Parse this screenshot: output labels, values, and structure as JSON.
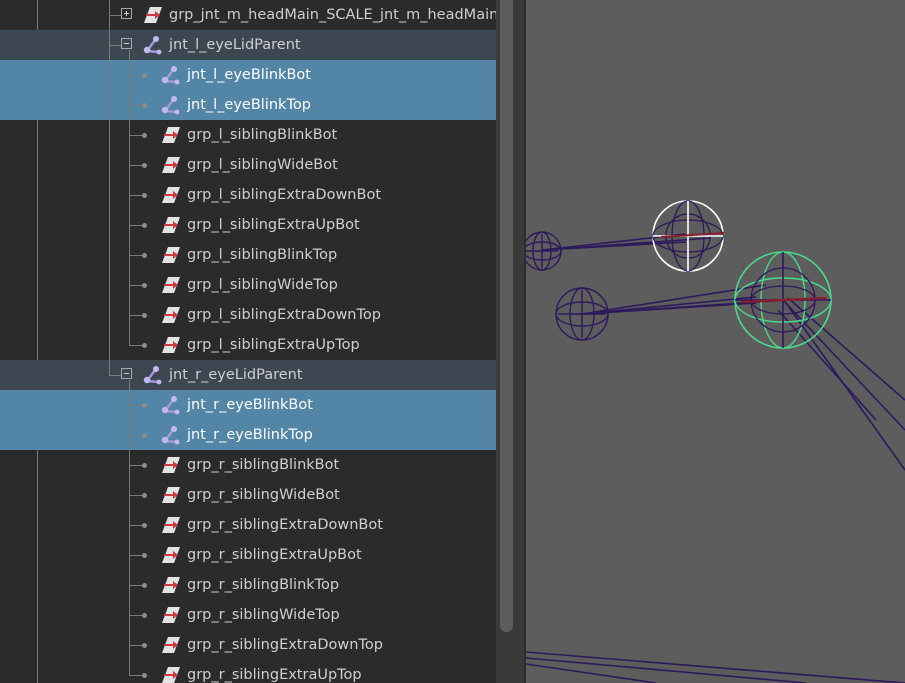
{
  "outliner": {
    "rows": [
      {
        "label": "grp_jnt_m_headMain_SCALE_jnt_m_headMain",
        "type": "group",
        "level": 1,
        "expander": "plus",
        "state": "normal"
      },
      {
        "label": "jnt_l_eyeLidParent",
        "type": "joint",
        "level": 1,
        "expander": "minus",
        "state": "parent"
      },
      {
        "label": "jnt_l_eyeBlinkBot",
        "type": "joint",
        "level": 2,
        "state": "selected"
      },
      {
        "label": "jnt_l_eyeBlinkTop",
        "type": "joint",
        "level": 2,
        "state": "selected"
      },
      {
        "label": "grp_l_siblingBlinkBot",
        "type": "group",
        "level": 2,
        "state": "normal"
      },
      {
        "label": "grp_l_siblingWideBot",
        "type": "group",
        "level": 2,
        "state": "normal"
      },
      {
        "label": "grp_l_siblingExtraDownBot",
        "type": "group",
        "level": 2,
        "state": "normal"
      },
      {
        "label": "grp_l_siblingExtraUpBot",
        "type": "group",
        "level": 2,
        "state": "normal"
      },
      {
        "label": "grp_l_siblingBlinkTop",
        "type": "group",
        "level": 2,
        "state": "normal"
      },
      {
        "label": "grp_l_siblingWideTop",
        "type": "group",
        "level": 2,
        "state": "normal"
      },
      {
        "label": "grp_l_siblingExtraDownTop",
        "type": "group",
        "level": 2,
        "state": "normal"
      },
      {
        "label": "grp_l_siblingExtraUpTop",
        "type": "group",
        "level": 2,
        "state": "normal"
      },
      {
        "label": "jnt_r_eyeLidParent",
        "type": "joint",
        "level": 1,
        "expander": "minus",
        "state": "parent"
      },
      {
        "label": "jnt_r_eyeBlinkBot",
        "type": "joint",
        "level": 2,
        "state": "selected"
      },
      {
        "label": "jnt_r_eyeBlinkTop",
        "type": "joint",
        "level": 2,
        "state": "selected"
      },
      {
        "label": "grp_r_siblingBlinkBot",
        "type": "group",
        "level": 2,
        "state": "normal"
      },
      {
        "label": "grp_r_siblingWideBot",
        "type": "group",
        "level": 2,
        "state": "normal"
      },
      {
        "label": "grp_r_siblingExtraDownBot",
        "type": "group",
        "level": 2,
        "state": "normal"
      },
      {
        "label": "grp_r_siblingExtraUpBot",
        "type": "group",
        "level": 2,
        "state": "normal"
      },
      {
        "label": "grp_r_siblingBlinkTop",
        "type": "group",
        "level": 2,
        "state": "normal"
      },
      {
        "label": "grp_r_siblingWideTop",
        "type": "group",
        "level": 2,
        "state": "normal"
      },
      {
        "label": "grp_r_siblingExtraDownTop",
        "type": "group",
        "level": 2,
        "state": "normal"
      },
      {
        "label": "grp_r_siblingExtraUpTop",
        "type": "group",
        "level": 2,
        "state": "normal"
      }
    ]
  },
  "icons": {
    "group": "transform-group-icon",
    "joint": "joint-icon",
    "expander_plus": "expand-plus-icon",
    "expander_minus": "collapse-minus-icon"
  },
  "colors": {
    "outliner_bg": "#2b2b2b",
    "selected_row": "#5285a6",
    "parent_row": "#3d4752",
    "viewport_bg": "#5d5d5d",
    "joint_wire": "#2d1a5c",
    "selected_joint_wire": "#ffffff",
    "lead_joint_wire": "#4cd98a"
  }
}
